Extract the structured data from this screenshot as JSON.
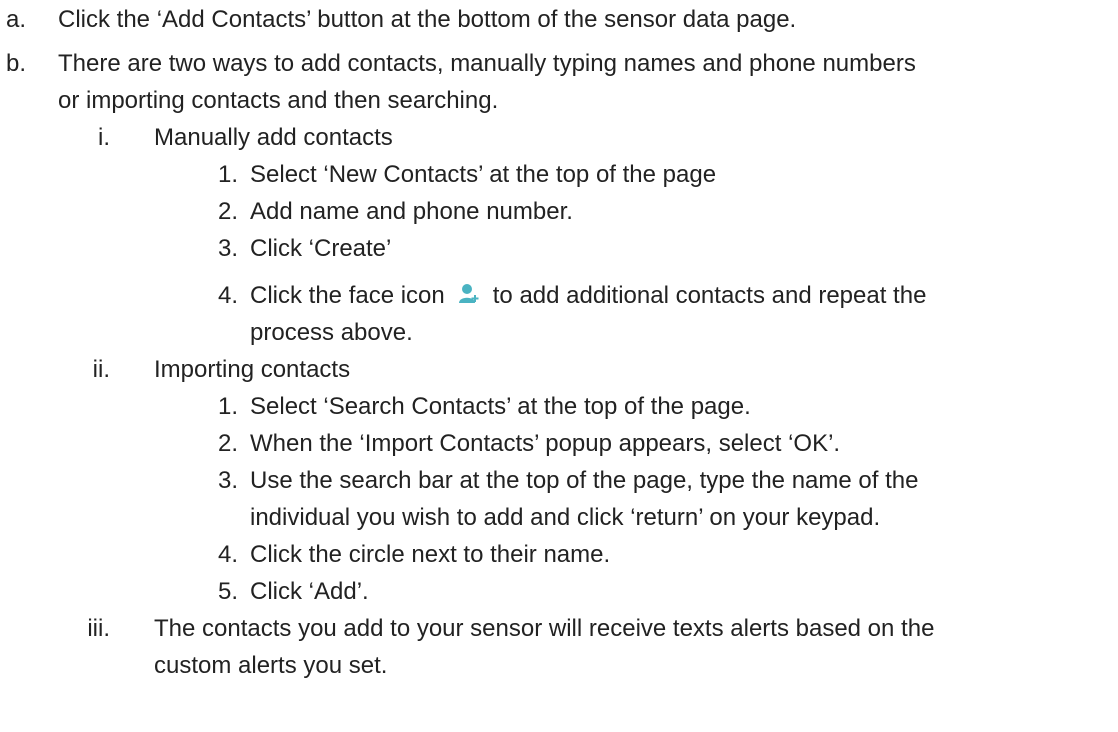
{
  "list": {
    "a": {
      "marker": "a.",
      "text": "Click the ‘Add Contacts’ button at the bottom of the sensor data page."
    },
    "b": {
      "marker": "b.",
      "text_line1": "There are two ways to add contacts, manually typing names and phone numbers",
      "text_line2": "or importing contacts and then searching.",
      "i": {
        "marker": "i.",
        "text": "Manually add contacts",
        "steps": [
          {
            "marker": "1.",
            "text": "Select ‘New Contacts’ at the top of the page"
          },
          {
            "marker": "2.",
            "text": "Add name and phone number."
          },
          {
            "marker": "3.",
            "text": "Click ‘Create’"
          },
          {
            "marker": "4.",
            "text_before_icon": "Click the face icon",
            "text_after_icon": "to add additional contacts and repeat the",
            "text_line2": "process above."
          }
        ]
      },
      "ii": {
        "marker": "ii.",
        "text": "Importing contacts",
        "steps": [
          {
            "marker": "1.",
            "text": "Select ‘Search Contacts’ at the top of the page."
          },
          {
            "marker": "2.",
            "text": "When the ‘Import Contacts’ popup appears, select ‘OK’."
          },
          {
            "marker": "3.",
            "text_line1": "Use the search bar at the top of the page, type the name of the",
            "text_line2": "individual you wish to add and click ‘return’ on your keypad."
          },
          {
            "marker": "4.",
            "text": "Click the circle next to their name."
          },
          {
            "marker": "5.",
            "text": "Click ‘Add’."
          }
        ]
      },
      "iii": {
        "marker": "iii.",
        "text_line1": "The contacts you add to your sensor will receive texts alerts based on the",
        "text_line2": "custom alerts you set."
      }
    }
  },
  "icons": {
    "face_icon": "add-contact-face-icon"
  },
  "colors": {
    "text": "#222222",
    "icon": "#4ab3c2"
  }
}
